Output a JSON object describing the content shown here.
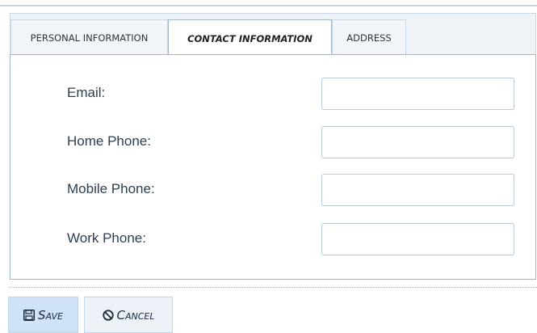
{
  "tabs": [
    {
      "label": "Personal Information"
    },
    {
      "label": "Contact Information"
    },
    {
      "label": "Address"
    }
  ],
  "form": {
    "email_label": "Email:",
    "home_phone_label": "Home Phone:",
    "mobile_phone_label": "Mobile Phone:",
    "work_phone_label": "Work Phone:",
    "email_value": "",
    "home_phone_value": "",
    "mobile_phone_value": "",
    "work_phone_value": ""
  },
  "actions": {
    "save_label": "Save",
    "cancel_label": "Cancel",
    "save_icon": "floppy-disk-icon",
    "cancel_icon": "cancel-circle-icon"
  },
  "colors": {
    "active_tab_border": "#9fb7cc",
    "save_bg": "#cfe2f8",
    "cancel_bg": "#edf2f8"
  }
}
